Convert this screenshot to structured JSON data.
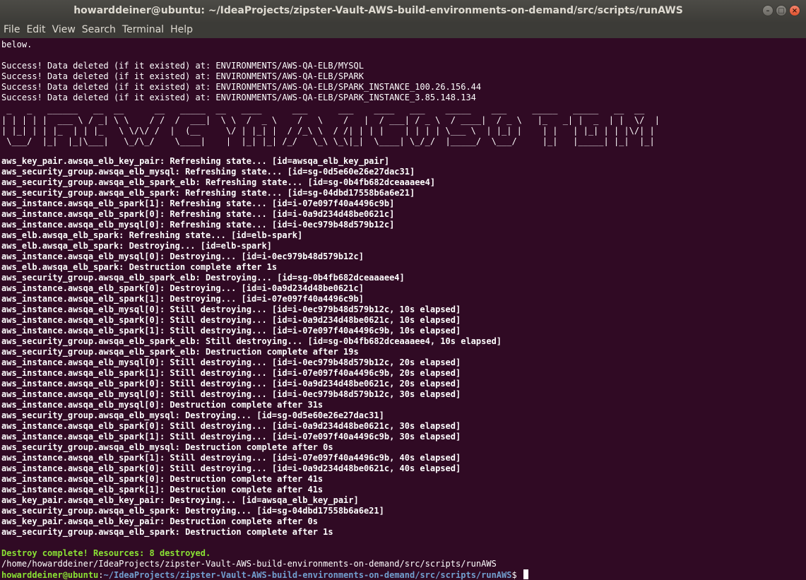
{
  "window": {
    "title": "howarddeiner@ubuntu: ~/IdeaProjects/zipster-Vault-AWS-build-environments-on-demand/src/scripts/runAWS",
    "controls": {
      "minimize": "–",
      "maximize": "□",
      "close": "×"
    }
  },
  "menu": [
    "File",
    "Edit",
    "View",
    "Search",
    "Terminal",
    "Help"
  ],
  "terminal": {
    "pre_lines": [
      "below.",
      "",
      "Success! Data deleted (if it existed) at: ENVIRONMENTS/AWS-QA-ELB/MYSQL",
      "Success! Data deleted (if it existed) at: ENVIRONMENTS/AWS-QA-ELB/SPARK",
      "Success! Data deleted (if it existed) at: ENVIRONMENTS/AWS-QA-ELB/SPARK_INSTANCE_100.26.156.44",
      "Success! Data deleted (if it existed) at: ENVIRONMENTS/AWS-QA-ELB/SPARK_INSTANCE_3.85.148.134"
    ],
    "banner": " _   _   ______   __  __      __   _____  __   ____      ___      ___    ____   ___    _____    ___     _____   _____   __  __ \n| | | | |  ___ \\ / _| \\ \\    / /  /  ___|  \\ \\  /  _ \\    /   \\    /   |  / ___| / _ \\  / ____|  / _ \\   |_   _| |  _  | |  \\/  |\n| |_| | | |_  | | |_   \\ \\/\\/ /  |  (__     \\/ | |_| |  / /_\\ \\  / /| | | |    | | | | \\___ \\  | |_| |    | |   | |_| | | |\\/| |\n \\___/  |_|  |_|\\___|   \\_/\\_/    \\____|    |  |_| |_| /_/   \\_\\ \\_\\|_|  \\____| \\_/_/  |_____/  \\___/     |_|   |_____| |_|  |_|",
    "log_lines": [
      "aws_key_pair.awsqa_elb_key_pair: Refreshing state... [id=awsqa_elb_key_pair]",
      "aws_security_group.awsqa_elb_mysql: Refreshing state... [id=sg-0d5e60e26e27dac31]",
      "aws_security_group.awsqa_elb_spark_elb: Refreshing state... [id=sg-0b4fb682dceaaaee4]",
      "aws_security_group.awsqa_elb_spark: Refreshing state... [id=sg-04dbd17558b6a6e21]",
      "aws_instance.awsqa_elb_spark[1]: Refreshing state... [id=i-07e097f40a4496c9b]",
      "aws_instance.awsqa_elb_spark[0]: Refreshing state... [id=i-0a9d234d48be0621c]",
      "aws_instance.awsqa_elb_mysql[0]: Refreshing state... [id=i-0ec979b48d579b12c]",
      "aws_elb.awsqa_elb_spark: Refreshing state... [id=elb-spark]",
      "aws_elb.awsqa_elb_spark: Destroying... [id=elb-spark]",
      "aws_instance.awsqa_elb_mysql[0]: Destroying... [id=i-0ec979b48d579b12c]",
      "aws_elb.awsqa_elb_spark: Destruction complete after 1s",
      "aws_security_group.awsqa_elb_spark_elb: Destroying... [id=sg-0b4fb682dceaaaee4]",
      "aws_instance.awsqa_elb_spark[0]: Destroying... [id=i-0a9d234d48be0621c]",
      "aws_instance.awsqa_elb_spark[1]: Destroying... [id=i-07e097f40a4496c9b]",
      "aws_instance.awsqa_elb_mysql[0]: Still destroying... [id=i-0ec979b48d579b12c, 10s elapsed]",
      "aws_instance.awsqa_elb_spark[0]: Still destroying... [id=i-0a9d234d48be0621c, 10s elapsed]",
      "aws_instance.awsqa_elb_spark[1]: Still destroying... [id=i-07e097f40a4496c9b, 10s elapsed]",
      "aws_security_group.awsqa_elb_spark_elb: Still destroying... [id=sg-0b4fb682dceaaaee4, 10s elapsed]",
      "aws_security_group.awsqa_elb_spark_elb: Destruction complete after 19s",
      "aws_instance.awsqa_elb_mysql[0]: Still destroying... [id=i-0ec979b48d579b12c, 20s elapsed]",
      "aws_instance.awsqa_elb_spark[1]: Still destroying... [id=i-07e097f40a4496c9b, 20s elapsed]",
      "aws_instance.awsqa_elb_spark[0]: Still destroying... [id=i-0a9d234d48be0621c, 20s elapsed]",
      "aws_instance.awsqa_elb_mysql[0]: Still destroying... [id=i-0ec979b48d579b12c, 30s elapsed]",
      "aws_instance.awsqa_elb_mysql[0]: Destruction complete after 31s",
      "aws_security_group.awsqa_elb_mysql: Destroying... [id=sg-0d5e60e26e27dac31]",
      "aws_instance.awsqa_elb_spark[0]: Still destroying... [id=i-0a9d234d48be0621c, 30s elapsed]",
      "aws_instance.awsqa_elb_spark[1]: Still destroying... [id=i-07e097f40a4496c9b, 30s elapsed]",
      "aws_security_group.awsqa_elb_mysql: Destruction complete after 0s",
      "aws_instance.awsqa_elb_spark[1]: Still destroying... [id=i-07e097f40a4496c9b, 40s elapsed]",
      "aws_instance.awsqa_elb_spark[0]: Still destroying... [id=i-0a9d234d48be0621c, 40s elapsed]",
      "aws_instance.awsqa_elb_spark[0]: Destruction complete after 41s",
      "aws_instance.awsqa_elb_spark[1]: Destruction complete after 41s",
      "aws_key_pair.awsqa_elb_key_pair: Destroying... [id=awsqa_elb_key_pair]",
      "aws_security_group.awsqa_elb_spark: Destroying... [id=sg-04dbd17558b6a6e21]",
      "aws_key_pair.awsqa_elb_key_pair: Destruction complete after 0s",
      "aws_security_group.awsqa_elb_spark: Destruction complete after 1s"
    ],
    "destroy_summary": "Destroy complete! Resources: 8 destroyed.",
    "cwd_line": "/home/howarddeiner/IdeaProjects/zipster-Vault-AWS-build-environments-on-demand/src/scripts/runAWS",
    "prompt_user": "howarddeiner@ubuntu",
    "prompt_sep": ":",
    "prompt_path": "~/IdeaProjects/zipster-Vault-AWS-build-environments-on-demand/src/scripts/runAWS",
    "prompt_symbol": "$ "
  }
}
